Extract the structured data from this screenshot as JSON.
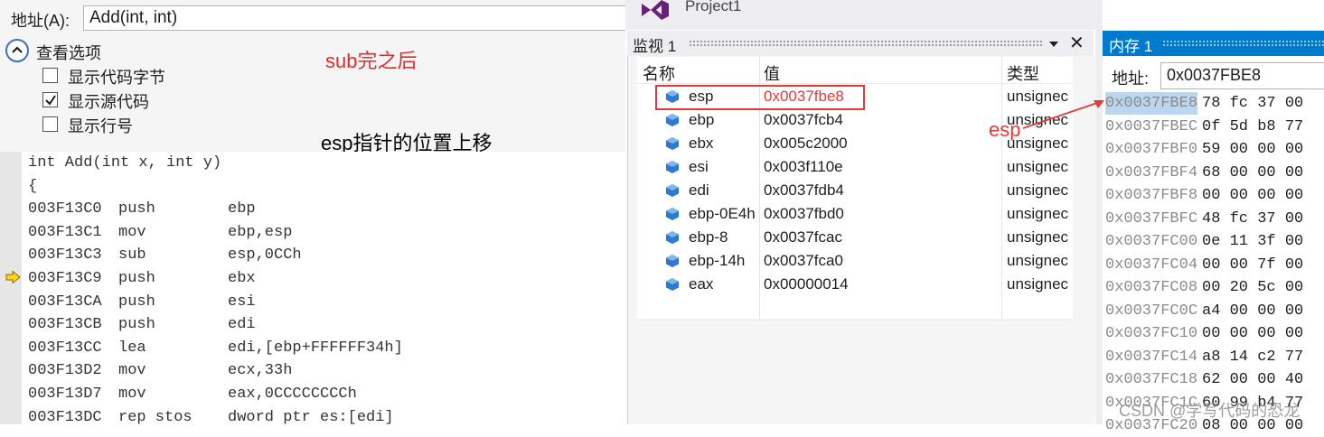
{
  "disasm": {
    "address_label": "地址(A):",
    "address_value": "Add(int, int)",
    "view_options_title": "查看选项",
    "options": [
      {
        "label": "显示代码字节",
        "checked": false
      },
      {
        "label": "显示源代码",
        "checked": true
      },
      {
        "label": "显示行号",
        "checked": false
      }
    ],
    "lines": [
      {
        "addr": "int Add(int x, int y)",
        "mnemonic": "",
        "operand": ""
      },
      {
        "addr": "{",
        "mnemonic": "",
        "operand": ""
      },
      {
        "addr": "003F13C0",
        "mnemonic": "push",
        "operand": "ebp"
      },
      {
        "addr": "003F13C1",
        "mnemonic": "mov",
        "operand": "ebp,esp"
      },
      {
        "addr": "003F13C3",
        "mnemonic": "sub",
        "operand": "esp,0CCh"
      },
      {
        "addr": "003F13C9",
        "mnemonic": "push",
        "operand": "ebx"
      },
      {
        "addr": "003F13CA",
        "mnemonic": "push",
        "operand": "esi"
      },
      {
        "addr": "003F13CB",
        "mnemonic": "push",
        "operand": "edi"
      },
      {
        "addr": "003F13CC",
        "mnemonic": "lea",
        "operand": "edi,[ebp+FFFFFF34h]"
      },
      {
        "addr": "003F13D2",
        "mnemonic": "mov",
        "operand": "ecx,33h"
      },
      {
        "addr": "003F13D7",
        "mnemonic": "mov",
        "operand": "eax,0CCCCCCCCh"
      },
      {
        "addr": "003F13DC",
        "mnemonic": "rep stos",
        "operand": "dword ptr es:[edi]"
      }
    ],
    "current_line_index": 5
  },
  "annotations": {
    "after_sub": "sub完之后",
    "esp_moved": "esp指针的位置上移",
    "esp_label": "esp"
  },
  "window": {
    "project_title": "Project1"
  },
  "watch": {
    "title": "监视 1",
    "columns": {
      "name": "名称",
      "value": "值",
      "type": "类型"
    },
    "rows": [
      {
        "name": "esp",
        "value": "0x0037fbe8",
        "type": "unsignec",
        "changed": true
      },
      {
        "name": "ebp",
        "value": "0x0037fcb4",
        "type": "unsignec",
        "changed": false
      },
      {
        "name": "ebx",
        "value": "0x005c2000",
        "type": "unsignec",
        "changed": false
      },
      {
        "name": "esi",
        "value": "0x003f110e",
        "type": "unsignec",
        "changed": false
      },
      {
        "name": "edi",
        "value": "0x0037fdb4",
        "type": "unsignec",
        "changed": false
      },
      {
        "name": "ebp-0E4h",
        "value": "0x0037fbd0",
        "type": "unsignec",
        "changed": false
      },
      {
        "name": "ebp-8",
        "value": "0x0037fcac",
        "type": "unsignec",
        "changed": false
      },
      {
        "name": "ebp-14h",
        "value": "0x0037fca0",
        "type": "unsignec",
        "changed": false
      },
      {
        "name": "eax",
        "value": "0x00000014",
        "type": "unsignec",
        "changed": false
      }
    ],
    "changed_color": "#e53935"
  },
  "memory": {
    "title": "内存 1",
    "address_label": "地址:",
    "address_value": "0x0037FBE8",
    "rows": [
      {
        "addr": "0x0037FBE8",
        "bytes": "78 fc 37 00",
        "selected": true
      },
      {
        "addr": "0x0037FBEC",
        "bytes": "0f 5d b8 77",
        "selected": false
      },
      {
        "addr": "0x0037FBF0",
        "bytes": "59 00 00 00",
        "selected": false
      },
      {
        "addr": "0x0037FBF4",
        "bytes": "68 00 00 00",
        "selected": false
      },
      {
        "addr": "0x0037FBF8",
        "bytes": "00 00 00 00",
        "selected": false
      },
      {
        "addr": "0x0037FBFC",
        "bytes": "48 fc 37 00",
        "selected": false
      },
      {
        "addr": "0x0037FC00",
        "bytes": "0e 11 3f 00",
        "selected": false
      },
      {
        "addr": "0x0037FC04",
        "bytes": "00 00 7f 00",
        "selected": false
      },
      {
        "addr": "0x0037FC08",
        "bytes": "00 20 5c 00",
        "selected": false
      },
      {
        "addr": "0x0037FC0C",
        "bytes": "a4 00 00 00",
        "selected": false
      },
      {
        "addr": "0x0037FC10",
        "bytes": "00 00 00 00",
        "selected": false
      },
      {
        "addr": "0x0037FC14",
        "bytes": "a8 14 c2 77",
        "selected": false
      },
      {
        "addr": "0x0037FC18",
        "bytes": "62 00 00 40",
        "selected": false
      },
      {
        "addr": "0x0037FC1C",
        "bytes": "60 99 b4 77",
        "selected": false
      },
      {
        "addr": "0x0037FC20",
        "bytes": "08 00 00 00",
        "selected": false
      }
    ]
  },
  "watermark": "CSDN @学写代码的恐龙",
  "colors": {
    "accent": "#007acc",
    "annotation_red": "#e53935"
  }
}
